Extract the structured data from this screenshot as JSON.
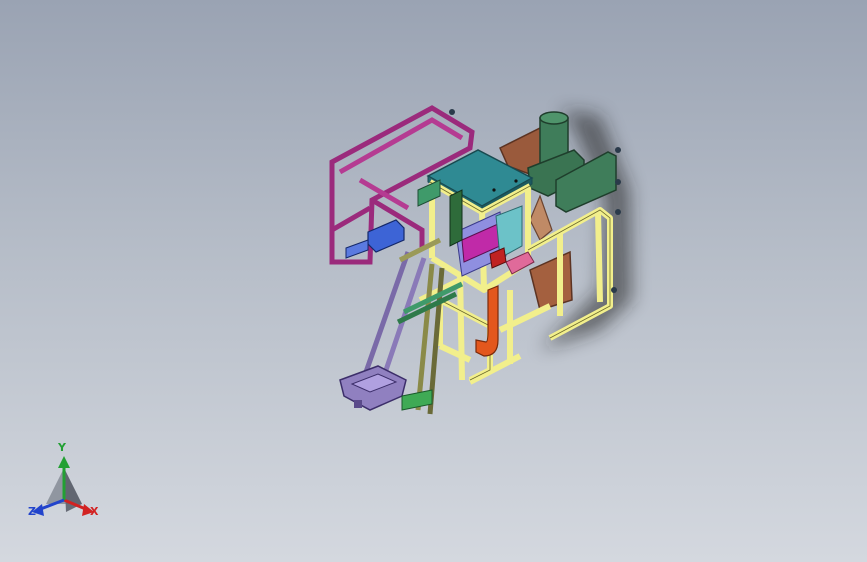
{
  "viewport": {
    "background_top": "#9aa3b3",
    "background_bottom": "#d4d8df"
  },
  "model": {
    "frame_yellow": "#f2ef8c",
    "frame_magenta": "#9b2a7c",
    "top_plate": "#2f8a93",
    "motor_green": "#3f7d5a",
    "hopper_brown": "#9a5a3c",
    "accent_orange": "#e3571d",
    "accent_blue": "#3d64d6",
    "frame_purple": "#7a6aa8",
    "bracket_green": "#3f9a6a"
  },
  "triad": {
    "x_label": "X",
    "y_label": "Y",
    "z_label": "Z",
    "x_color": "#d22222",
    "y_color": "#22a033",
    "z_color": "#2244cc"
  }
}
